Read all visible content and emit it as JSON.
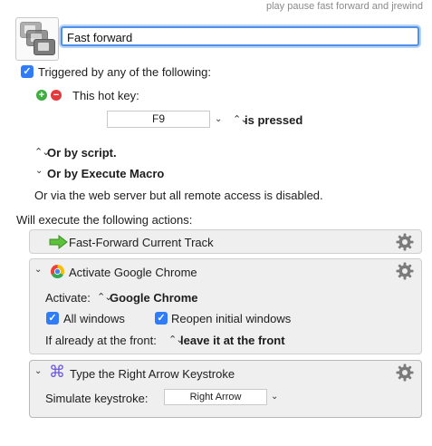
{
  "header": {
    "tags_text": "play pause fast forward and jrewind",
    "macro_name": "Fast forward"
  },
  "trigger": {
    "triggered_label": "Triggered by any of the following:",
    "hotkey_label": "This hot key:",
    "hotkey_value": "F9",
    "hotkey_condition": "is pressed",
    "or_by_script": "Or by script.",
    "or_by_execute_macro": "Or by Execute Macro",
    "web_server_note": "Or via the web server but all remote access is disabled."
  },
  "actions": {
    "heading": "Will execute the following actions:",
    "items": [
      {
        "title": "Fast-Forward Current Track"
      },
      {
        "title": "Activate Google Chrome",
        "activate_label": "Activate:",
        "activate_value": "Google Chrome",
        "all_windows_label": "All windows",
        "reopen_label": "Reopen initial windows",
        "front_label": "If already at the front:",
        "front_value": "leave it at the front"
      },
      {
        "title": "Type the Right Arrow Keystroke",
        "simulate_label": "Simulate keystroke:",
        "simulate_value": "Right Arrow"
      }
    ]
  },
  "colors": {
    "accent": "#2f7cf6",
    "focus_ring": "#4f90e8",
    "plus_green": "#3fae3f",
    "minus_red": "#e23b3b",
    "panel_bg": "#efefef",
    "keystroke_icon": "#6b57d6"
  },
  "icons": {
    "macro": "keyboard-stack-icon",
    "fast_forward_action": "green-arrow-icon",
    "chrome_action": "chrome-icon",
    "keystroke_action": "command-key-icon",
    "action_menu": "gear-icon"
  }
}
